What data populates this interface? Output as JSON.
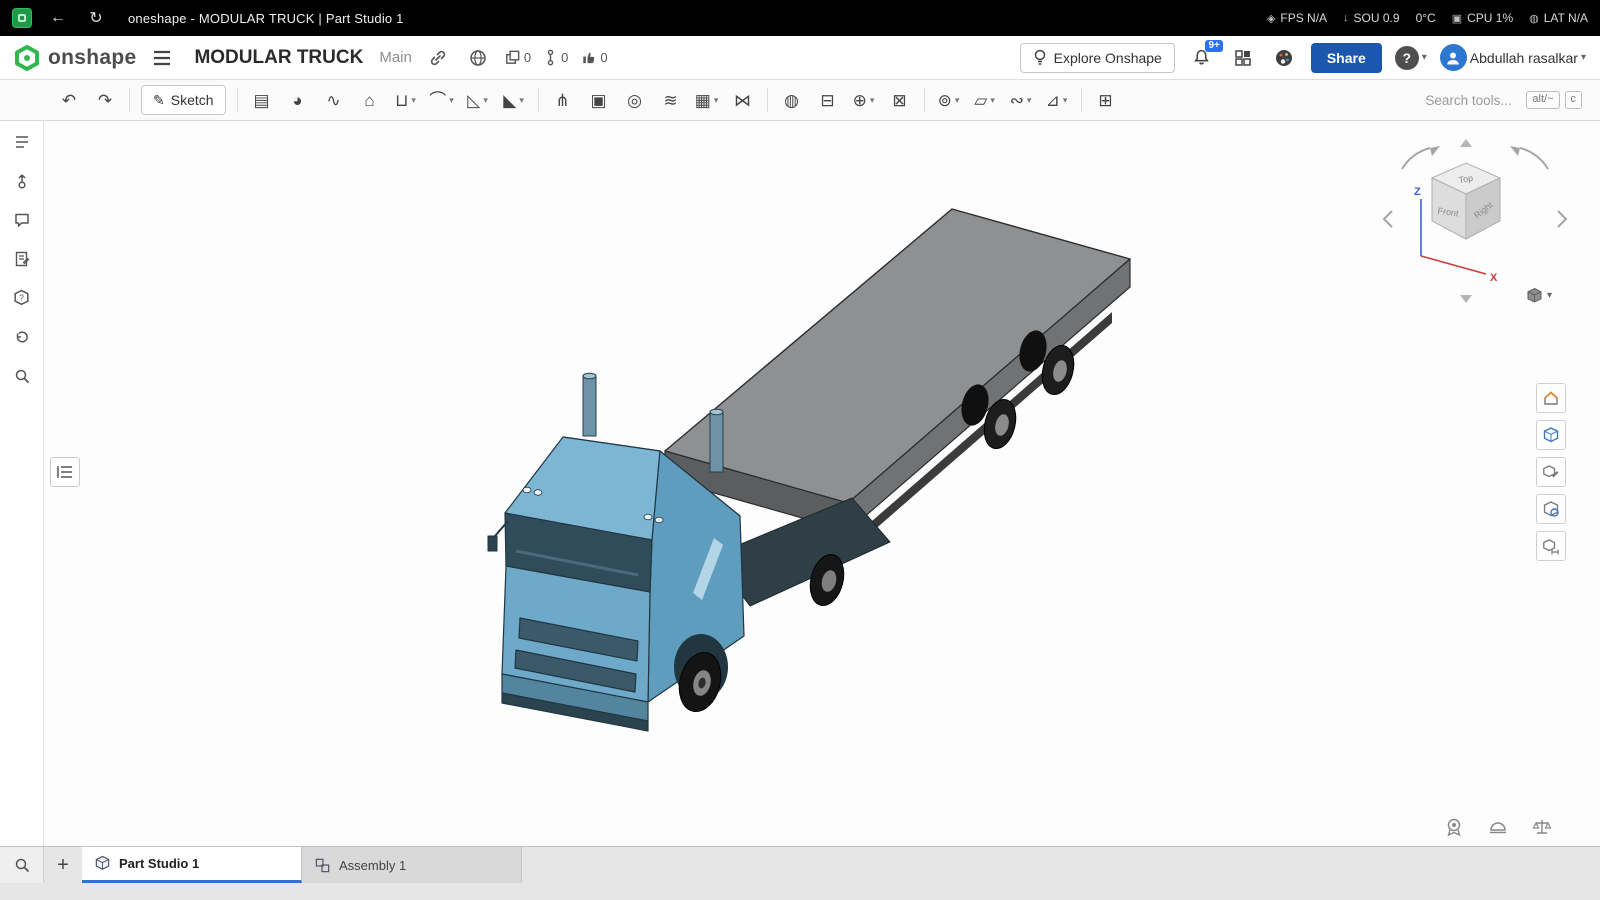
{
  "browser": {
    "tab_title": "oneshape - MODULAR TRUCK | Part Studio 1",
    "stats": [
      {
        "glyph": "◈",
        "label": "FPS N/A"
      },
      {
        "glyph": "↓",
        "label": "SOU 0.9"
      },
      {
        "glyph": "",
        "label": "0°C"
      },
      {
        "glyph": "▣",
        "label": "CPU 1%"
      },
      {
        "glyph": "◍",
        "label": "LAT N/A"
      }
    ]
  },
  "header": {
    "logo_text": "onshape",
    "document_title": "MODULAR TRUCK",
    "workspace_label": "Main",
    "copies_count": "0",
    "versions_count": "0",
    "likes_count": "0",
    "explore_button_label": "Explore Onshape",
    "notifications_badge": "9+",
    "share_button_label": "Share",
    "help_label": "?",
    "user_name": "Abdullah rasalkar"
  },
  "toolbar": {
    "undo_glyph": "↶",
    "redo_glyph": "↷",
    "sketch_icon_glyph": "✎",
    "sketch_label": "Sketch",
    "chevron": "▾",
    "search_placeholder": "Search tools...",
    "kbd_shortcut_1": "alt/~",
    "kbd_shortcut_2": "c",
    "tools": [
      {
        "name": "extrude",
        "glyph": "▤",
        "dropdown": false
      },
      {
        "name": "revolve",
        "glyph": "◕",
        "dropdown": false
      },
      {
        "name": "sweep",
        "glyph": "∿",
        "dropdown": false
      },
      {
        "name": "loft",
        "glyph": "⌂",
        "dropdown": false
      },
      {
        "name": "thicken",
        "glyph": "⊔",
        "dropdown": true
      },
      {
        "name": "fillet",
        "glyph": "⌒",
        "dropdown": true
      },
      {
        "name": "chamfer",
        "glyph": "◺",
        "dropdown": true
      },
      {
        "name": "draft",
        "glyph": "◣",
        "dropdown": true
      },
      {
        "name": "rib",
        "glyph": "⋔",
        "dropdown": false
      },
      {
        "name": "shell",
        "glyph": "▣",
        "dropdown": false
      },
      {
        "name": "hole",
        "glyph": "◎",
        "dropdown": false
      },
      {
        "name": "thread",
        "glyph": "≋",
        "dropdown": false
      },
      {
        "name": "pattern",
        "glyph": "▦",
        "dropdown": true
      },
      {
        "name": "mirror",
        "glyph": "⋈",
        "dropdown": false
      },
      {
        "name": "boolean",
        "glyph": "◍",
        "dropdown": false
      },
      {
        "name": "split",
        "glyph": "⊟",
        "dropdown": false
      },
      {
        "name": "transform",
        "glyph": "⊕",
        "dropdown": true
      },
      {
        "name": "delete-part",
        "glyph": "⊠",
        "dropdown": false
      },
      {
        "name": "modify-fillet",
        "glyph": "⊚",
        "dropdown": true
      },
      {
        "name": "plane",
        "glyph": "▱",
        "dropdown": true
      },
      {
        "name": "curve",
        "glyph": "∾",
        "dropdown": true
      },
      {
        "name": "surface",
        "glyph": "⊿",
        "dropdown": true
      },
      {
        "name": "box-select",
        "glyph": "⊞",
        "dropdown": false
      }
    ]
  },
  "viewcube": {
    "top": "Top",
    "front": "Front",
    "right": "Right",
    "axis_z": "Z",
    "axis_x": "X"
  },
  "tabs": [
    {
      "label": "Part Studio 1",
      "active": true
    },
    {
      "label": "Assembly 1",
      "active": false
    }
  ]
}
